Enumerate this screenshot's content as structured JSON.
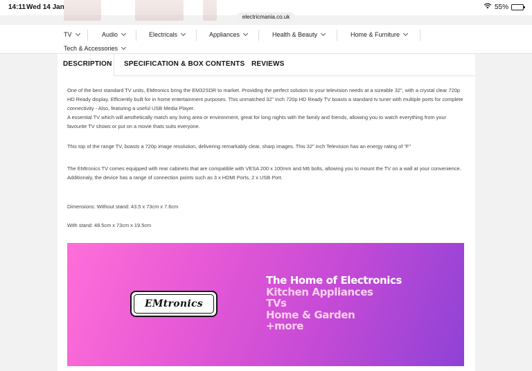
{
  "status_bar": {
    "time": "14:11",
    "date": "Wed 14 Jan",
    "battery_text": "55%",
    "battery_level": 0.55
  },
  "browser": {
    "url": "electricmania.co.uk"
  },
  "nav": {
    "items": [
      {
        "label": "TV"
      },
      {
        "label": "Audio"
      },
      {
        "label": "Electricals"
      },
      {
        "label": "Appliances"
      },
      {
        "label": "Health & Beauty"
      },
      {
        "label": "Home & Furniture"
      },
      {
        "label": "Tech & Accessories"
      }
    ]
  },
  "tabs": [
    {
      "label": "DESCRIPTION",
      "active": true
    },
    {
      "label": "SPECIFICATION & BOX CONTENTS",
      "active": false
    },
    {
      "label": "REVIEWS",
      "active": false
    }
  ],
  "description": {
    "p1": "One of the best standard TV units, EMtronics bring the EM32SDR to market. Providing the perfect solution to your television needs at a sizeable 32\", with a crystal clear 720p HD Ready display. Efficiently built for in home entertainment purposes. This unmatched 32\" Inch 720p HD Ready TV boasts a standard tv tuner with multiple ports for complete connectivity - Also, featuring a useful USB Media Player.",
    "p2": "A essential TV which will aesthetically match any living area or environment, great for long nights with the family and friends, allowing you to watch everything from your favourite TV shows or put on a movie thats suits everyone.",
    "p3": "This top of the range TV, boasts a 720p image resolution, delivering remarkably clear, sharp images. This 32\" inch Television has an energy rating of \"F\"",
    "p4": "The EMtronics TV comes equipped with rear cabinets that are compatible with VESA 200 x 100mm and M6 bolts, allowing you to mount the TV on a wall at your convenience. Additionaly, the device has a range of connection points such as 3 x HDMI Ports, 2 x USB Port.",
    "dimensions_without": "Dimensions: Without stand: 43.5 x 73cm x 7.6cm",
    "dimensions_with": "With stand: 48.5cm x 73cm x 19.5cm"
  },
  "banner": {
    "logo_text": "EMtronics",
    "lines": [
      {
        "text": "The Home of Electronics",
        "color": "#ffffff"
      },
      {
        "text": "Kitchen Appliances",
        "color": "#ffd0f0"
      },
      {
        "text": "TVs",
        "color": "#ffd0f0"
      },
      {
        "text": "Home & Garden",
        "color": "#ffd0f0"
      },
      {
        "text": "+more",
        "color": "#ffd0f0"
      }
    ]
  }
}
